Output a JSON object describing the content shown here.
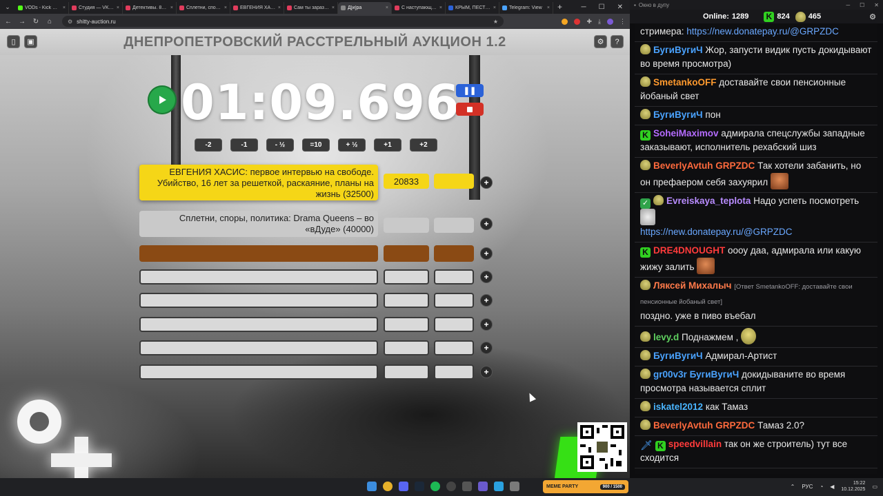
{
  "browser": {
    "tabs": [
      {
        "title": "VODs - Kick Dashboard",
        "color": "#53fc18"
      },
      {
        "title": "Студия — VK Видео",
        "color": "#e03c5c"
      },
      {
        "title": "Детективы. 83 серия",
        "color": "#e03c5c"
      },
      {
        "title": "Сплетни, споры, политика",
        "color": "#e03c5c"
      },
      {
        "title": "ЕВГЕНИЯ ХАСИС",
        "color": "#e03c5c"
      },
      {
        "title": "Сам ты заразный",
        "color": "#e03c5c"
      },
      {
        "title": "Д[и]ра",
        "color": "#888888"
      },
      {
        "title": "С наступающим",
        "color": "#e03c5c"
      },
      {
        "title": "КРЫМ, ПЕСТИЦИДЫ",
        "color": "#2b62d8"
      },
      {
        "title": "Telegram: View",
        "color": "#4aa3ff"
      }
    ],
    "active_tab_index": 6,
    "url": "shitty-auction.ru"
  },
  "auction": {
    "title": "ДНЕПРОПЕТРОВСКИЙ РАССТРЕЛЬНЫЙ АУКЦИОН 1.2",
    "timer": "01:09.696",
    "step_buttons": [
      "-2",
      "-1",
      "- ½",
      "=10",
      "+ ½",
      "+1",
      "+2"
    ],
    "lots": [
      {
        "name": "ЕВГЕНИЯ ХАСИС: первое интервью на свободе. Убийство, 16 лет за решеткой, раскаяние, планы на жизнь (32500)",
        "amount": "20833",
        "style": "yellow"
      },
      {
        "name": "Сплетни, споры, политика: Drama Queens – во «вДуде» (40000)",
        "amount": "",
        "style": "silver"
      },
      {
        "name": "",
        "amount": "",
        "style": "brown"
      },
      {
        "name": "",
        "amount": "",
        "style": "empty"
      },
      {
        "name": "",
        "amount": "",
        "style": "empty"
      },
      {
        "name": "",
        "amount": "",
        "style": "empty"
      },
      {
        "name": "",
        "amount": "",
        "style": "empty"
      },
      {
        "name": "",
        "amount": "",
        "style": "empty"
      }
    ],
    "add_label": "+"
  },
  "chat": {
    "window_title": "Окно в дупу",
    "online_label": "Online:",
    "online_count": "1289",
    "kick_count": "824",
    "rock_count": "465",
    "messages": [
      {
        "badges": [],
        "user": "",
        "user_color": "#e8e8e8",
        "mention": "",
        "text": "стримера: ",
        "link": "https://new.donatepay.ru/@GRPZDC",
        "emote": ""
      },
      {
        "badges": [
          "rock"
        ],
        "user": "БугиВугиЧ",
        "user_color": "#4aa3ff",
        "mention": "",
        "text": "Жор, запусти видик пусть докидывают во время просмотра)",
        "link": "",
        "emote": ""
      },
      {
        "badges": [
          "rock"
        ],
        "user": "SmetankoOFF",
        "user_color": "#ff9a2e",
        "mention": "",
        "text": "доставайте свои пенсионные йобаный свет",
        "link": "",
        "emote": ""
      },
      {
        "badges": [
          "rock"
        ],
        "user": "БугиВугиЧ",
        "user_color": "#4aa3ff",
        "mention": "",
        "text": "пон",
        "link": "",
        "emote": ""
      },
      {
        "badges": [
          "kick"
        ],
        "user": "SoheiMaximov",
        "user_color": "#b56cff",
        "mention": "",
        "text": "адмирала спецслужбы западные заказывают, исполнитель рехабский шиз",
        "link": "",
        "emote": ""
      },
      {
        "badges": [
          "rock"
        ],
        "user": "BeverlyAvtuh",
        "user_color": "#ff6a3d",
        "mention": "GRPZDC",
        "text": "Так хотели забанить, но он префаером себя захуярил",
        "link": "",
        "emote": "face"
      },
      {
        "badges": [
          "check",
          "rock"
        ],
        "user": "Evreiskaya_teplota",
        "user_color": "#b88cff",
        "mention": "",
        "text": "Надо успеть посмотреть",
        "link": "https://new.donatepay.ru/@GRPZDC",
        "emote": "cat"
      },
      {
        "badges": [
          "kick"
        ],
        "user": "DRE4DNOUGHT",
        "user_color": "#ff3b3b",
        "mention": "",
        "text": "оооу даа, адмирала или какую жижу залить",
        "link": "",
        "emote": "face"
      },
      {
        "badges": [
          "rock"
        ],
        "user": "Ляксей Михалыч",
        "user_color": "#ff7a4a",
        "mention": "",
        "reply": "[Ответ SmetankoOFF: доставайте свои пенсионные йобаный свет]",
        "text": "поздно.  уже в пиво въебал",
        "link": "",
        "emote": ""
      },
      {
        "badges": [
          "rock"
        ],
        "user": "levy.d",
        "user_color": "#5fd05f",
        "mention": "",
        "text": "Поднажмем ,",
        "link": "",
        "emote": "rock"
      },
      {
        "badges": [
          "rock"
        ],
        "user": "БугиВугиЧ",
        "user_color": "#4aa3ff",
        "mention": "",
        "text": "Адмирал-Артист",
        "link": "",
        "emote": ""
      },
      {
        "badges": [
          "rock"
        ],
        "user": "gr00v3r",
        "user_color": "#4aa3ff",
        "mention": "БугиВугиЧ",
        "text": "докидываните во время просмотра называется сплит",
        "link": "",
        "emote": ""
      },
      {
        "badges": [
          "rock"
        ],
        "user": "iskatel2012",
        "user_color": "#4ab5ff",
        "mention": "",
        "text": "как Тамаз",
        "link": "",
        "emote": ""
      },
      {
        "badges": [
          "rock"
        ],
        "user": "BeverlyAvtuh",
        "user_color": "#ff6a3d",
        "mention": "GRPZDC",
        "text": "Тамаз 2.0?",
        "link": "",
        "emote": ""
      },
      {
        "badges": [
          "sword",
          "kick"
        ],
        "user": "speedvillain",
        "user_color": "#ff3b3b",
        "mention": "",
        "text": "так он же строитель) тут все сходится",
        "link": "",
        "emote": ""
      }
    ]
  },
  "taskbar": {
    "widget_label": "MEME PARTY",
    "widget_progress": "900 / 1500",
    "lang": "РУС",
    "time": "15:22",
    "date": "10.12.2025"
  }
}
